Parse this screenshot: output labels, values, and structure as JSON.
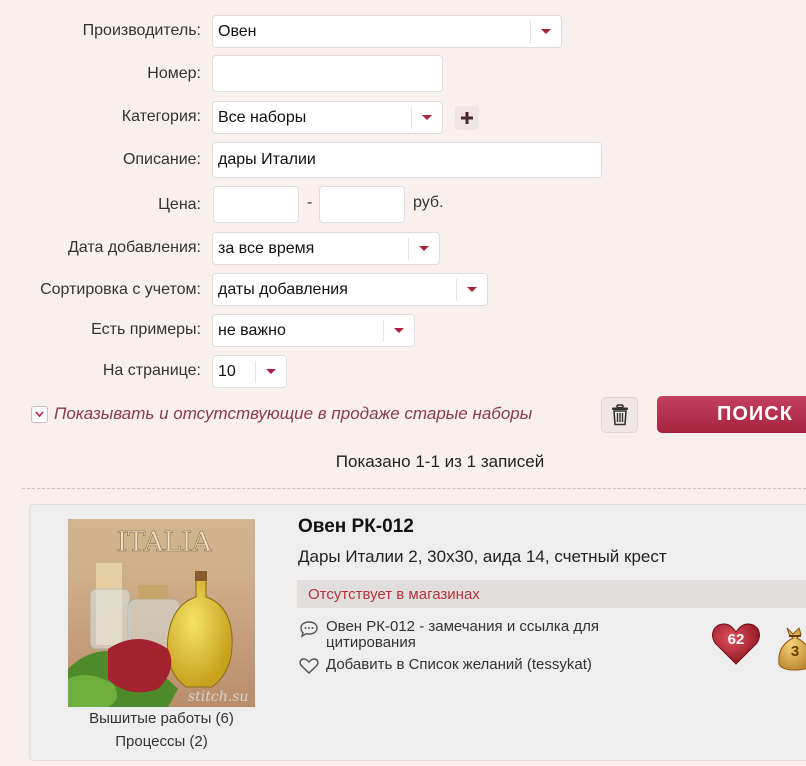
{
  "form": {
    "manufacturer": {
      "label": "Производитель:",
      "value": "Овен"
    },
    "number": {
      "label": "Номер:",
      "value": ""
    },
    "category": {
      "label": "Категория:",
      "value": "Все наборы"
    },
    "description": {
      "label": "Описание:",
      "value": "дары Италии"
    },
    "price": {
      "label": "Цена:",
      "from": "",
      "to": "",
      "dash": "-",
      "currency": "руб."
    },
    "date_added": {
      "label": "Дата добавления:",
      "value": "за все время"
    },
    "sort": {
      "label": "Сортировка с учетом:",
      "value": "даты добавления"
    },
    "has_examples": {
      "label": "Есть примеры:",
      "value": "не важно"
    },
    "per_page": {
      "label": "На странице:",
      "value": "10"
    },
    "show_old_label": "Показывать и отсутствующие в продаже старые наборы",
    "search_label": "ПОИСК"
  },
  "results": {
    "summary": "Показано 1-1 из 1 записей",
    "items": [
      {
        "title": "Овен РК-012",
        "description": "Дары Италии 2, 30х30, аида 14, счетный крест",
        "availability": "Отсутствует в магазинах",
        "remarks_link": "Овен РК-012 - замечания и ссылка для цитирования",
        "wishlist_link": "Добавить в Список желаний (tessykat)",
        "works_link": "Вышитые работы (6)",
        "processes_link": "Процессы (2)",
        "likes": "62",
        "bag_count": "3",
        "image_title": "ITALIA",
        "image_watermark": "stitch.su"
      }
    ]
  },
  "colors": {
    "accent": "#a8233f",
    "absent_text": "#b5333a",
    "page_bg": "#f9f0ee"
  }
}
